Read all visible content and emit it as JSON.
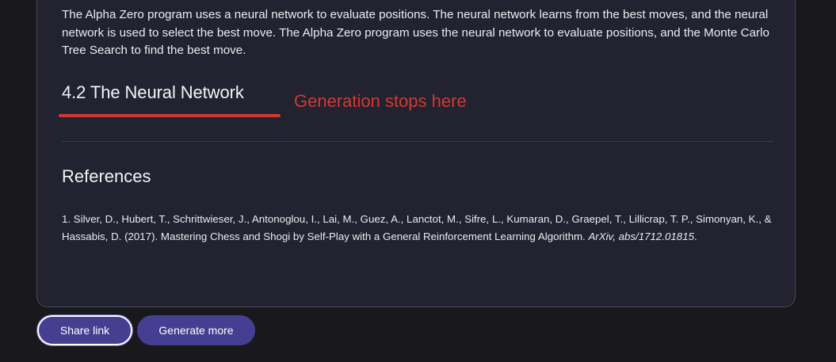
{
  "article": {
    "intro_paragraph": "The Alpha Zero program uses a neural network to evaluate positions. The neural network learns from the best moves, and the neural network is used to select the best move. The Alpha Zero program uses the neural network to evaluate positions, and the Monte Carlo Tree Search to find the best move.",
    "section_heading": "4.2 The Neural Network",
    "annotation": "Generation stops here",
    "references_heading": "References",
    "reference_1": {
      "authors_and_title": "1. Silver, D., Hubert, T., Schrittwieser, J., Antonoglou, I., Lai, M., Guez, A., Lanctot, M., Sifre, L., Kumaran, D., Graepel, T., Lillicrap, T. P., Simonyan, K., & Hassabis, D. (2017). Mastering Chess and Shogi by Self-Play with a General Reinforcement Learning Algorithm. ",
      "journal": "ArXiv, abs/1712.01815",
      "end": "."
    }
  },
  "actions": {
    "share_label": "Share link",
    "generate_label": "Generate more"
  },
  "colors": {
    "background": "#19181c",
    "card": "#222230",
    "button": "#453f92",
    "annotation_red": "#d23a2f"
  }
}
